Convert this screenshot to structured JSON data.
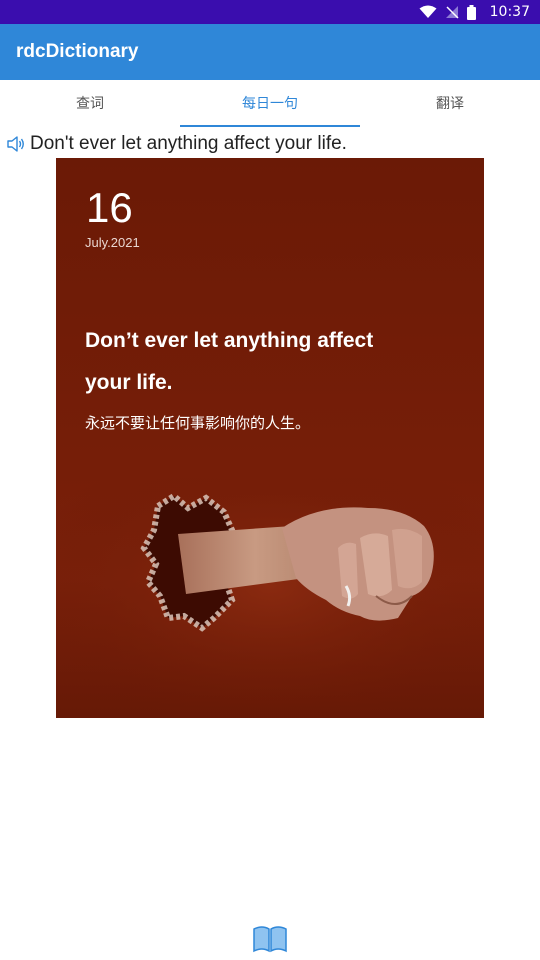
{
  "status_bar": {
    "time": "10:37",
    "icons": [
      "wifi-icon",
      "signal-off-icon",
      "battery-icon"
    ]
  },
  "appbar": {
    "title": "rdcDictionary"
  },
  "tabs": [
    {
      "label": "查词",
      "active": false
    },
    {
      "label": "每日一句",
      "active": true
    },
    {
      "label": "翻译",
      "active": false
    }
  ],
  "daily": {
    "sentence": "Don't ever let anything affect your life.",
    "card": {
      "day": "16",
      "date": "July.2021",
      "english": "Don’t ever let anything affect your life.",
      "chinese": "永远不要让任何事影响你的人生。"
    }
  },
  "bottom": {
    "icon": "book-icon"
  },
  "colors": {
    "status_bar": "#3a0dae",
    "appbar": "#2f87d8",
    "accent": "#2f87d8",
    "card_bg": "#761e08"
  }
}
